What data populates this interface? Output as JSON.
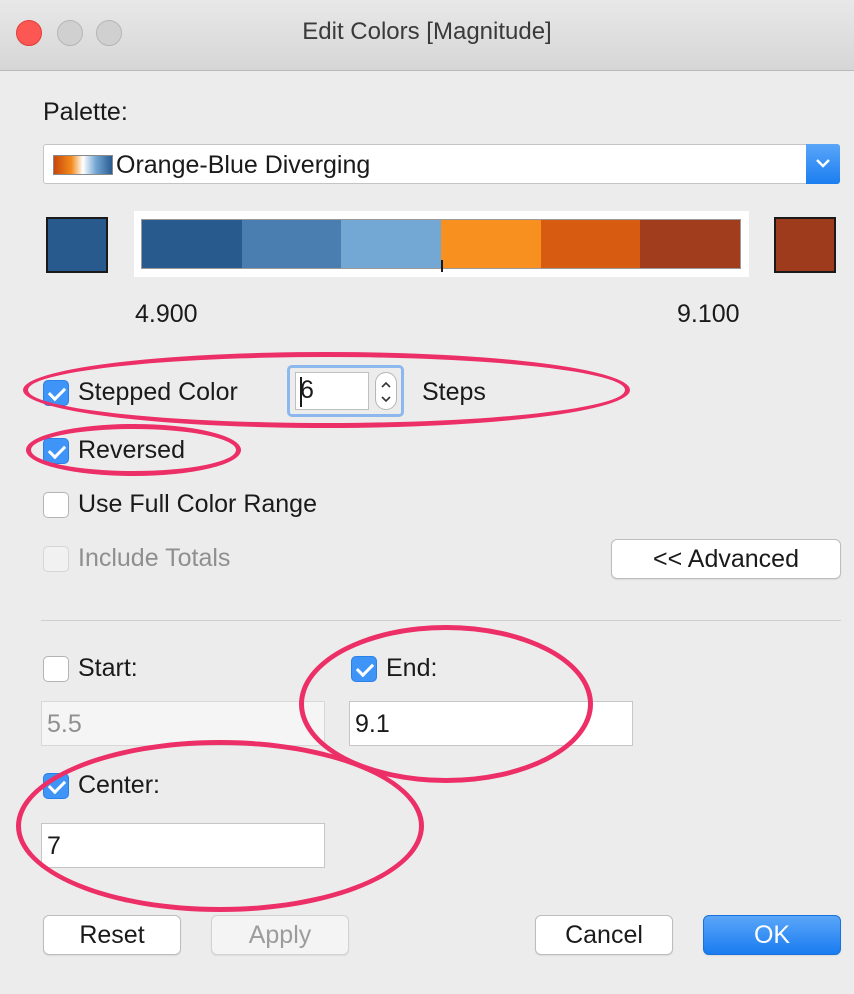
{
  "window": {
    "title": "Edit Colors [Magnitude]"
  },
  "palette": {
    "label": "Palette:",
    "selected": "Orange-Blue Diverging"
  },
  "ramp": {
    "start_color": "#285a8e",
    "end_color": "#9e3b1d",
    "segments": [
      "#285a8e",
      "#4a7eb0",
      "#74a8d4",
      "#f7901f",
      "#d85b12",
      "#a13c1d"
    ],
    "min_label": "4.900",
    "max_label": "9.100"
  },
  "options": {
    "stepped_color": {
      "label": "Stepped Color",
      "checked": true
    },
    "steps": {
      "value": "6",
      "label": "Steps"
    },
    "reversed": {
      "label": "Reversed",
      "checked": true
    },
    "use_full_range": {
      "label": "Use Full Color Range",
      "checked": false
    },
    "include_totals": {
      "label": "Include Totals",
      "checked": false,
      "disabled": true
    },
    "advanced_button": "<< Advanced"
  },
  "range": {
    "start": {
      "label": "Start:",
      "checked": false,
      "value": "5.5"
    },
    "end": {
      "label": "End:",
      "checked": true,
      "value": "9.1"
    },
    "center": {
      "label": "Center:",
      "checked": true,
      "value": "7"
    }
  },
  "buttons": {
    "reset": "Reset",
    "apply": "Apply",
    "cancel": "Cancel",
    "ok": "OK"
  },
  "colors": {
    "accent": "#3e94f7",
    "highlight": "#ec2f66"
  }
}
